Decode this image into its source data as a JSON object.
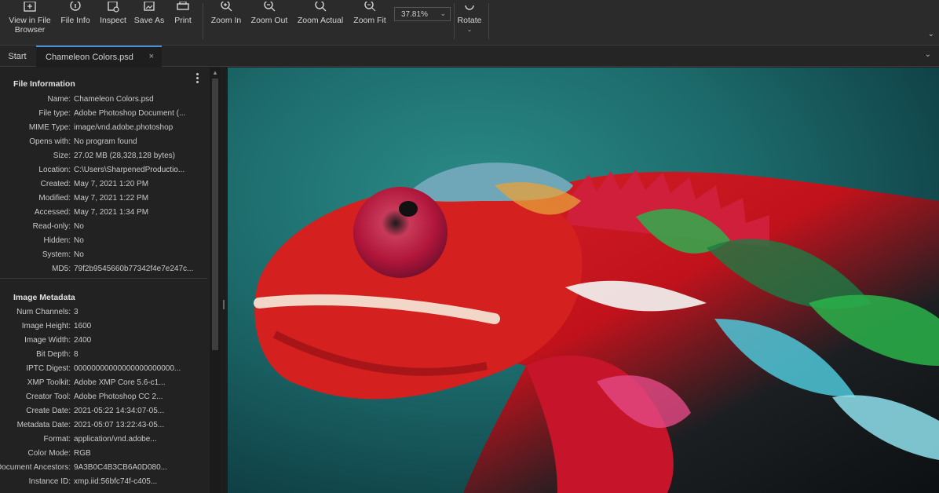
{
  "toolbar": {
    "buttons": [
      {
        "label": "View in File Browser",
        "line1": "View in File",
        "line2": "Browser",
        "icon": "folder-icon"
      },
      {
        "label": "File Info",
        "icon": "info-icon"
      },
      {
        "label": "Inspect",
        "icon": "inspect-icon"
      },
      {
        "label": "Save As",
        "icon": "save-as-icon"
      },
      {
        "label": "Print",
        "icon": "print-icon"
      },
      {
        "label": "Zoom In",
        "icon": "zoom-in-icon"
      },
      {
        "label": "Zoom Out",
        "icon": "zoom-out-icon"
      },
      {
        "label": "Zoom Actual",
        "icon": "zoom-actual-icon"
      },
      {
        "label": "Zoom Fit",
        "icon": "zoom-fit-icon"
      },
      {
        "label": "Rotate",
        "icon": "rotate-icon"
      }
    ],
    "zoom_value": "37.81%"
  },
  "tabs": {
    "start_label": "Start",
    "active_label": "Chameleon Colors.psd",
    "close_glyph": "×"
  },
  "file_info": {
    "title": "File Information",
    "rows": [
      {
        "key": "Name:",
        "value": "Chameleon Colors.psd"
      },
      {
        "key": "File type:",
        "value": "Adobe Photoshop Document (..."
      },
      {
        "key": "MIME Type:",
        "value": "image/vnd.adobe.photoshop"
      },
      {
        "key": "Opens with:",
        "value": "No program found"
      },
      {
        "key": "Size:",
        "value": "27.02 MB (28,328,128 bytes)"
      },
      {
        "key": "Location:",
        "value": "C:\\Users\\SharpenedProductio..."
      },
      {
        "key": "Created:",
        "value": "May 7, 2021 1:20 PM"
      },
      {
        "key": "Modified:",
        "value": "May 7, 2021 1:22 PM"
      },
      {
        "key": "Accessed:",
        "value": "May 7, 2021 1:34 PM"
      },
      {
        "key": "Read-only:",
        "value": "No"
      },
      {
        "key": "Hidden:",
        "value": "No"
      },
      {
        "key": "System:",
        "value": "No"
      },
      {
        "key": "MD5:",
        "value": "79f2b9545660b77342f4e7e247c..."
      }
    ]
  },
  "image_metadata": {
    "title": "Image Metadata",
    "rows": [
      {
        "key": "Num Channels:",
        "value": "3"
      },
      {
        "key": "Image Height:",
        "value": "1600"
      },
      {
        "key": "Image Width:",
        "value": "2400"
      },
      {
        "key": "Bit Depth:",
        "value": "8"
      },
      {
        "key": "IPTC Digest:",
        "value": "00000000000000000000000..."
      },
      {
        "key": "XMP Toolkit:",
        "value": "Adobe XMP Core 5.6-c1..."
      },
      {
        "key": "Creator Tool:",
        "value": "Adobe Photoshop CC 2..."
      },
      {
        "key": "Create Date:",
        "value": "2021-05:22 14:34:07-05..."
      },
      {
        "key": "Metadata Date:",
        "value": "2021-05:07 13:22:43-05..."
      },
      {
        "key": "Format:",
        "value": "application/vnd.adobe..."
      },
      {
        "key": "Color Mode:",
        "value": "RGB"
      },
      {
        "key": "Document Ancestors:",
        "value": "9A3B0C4B3CB6A0D080..."
      },
      {
        "key": "Instance ID:",
        "value": "xmp.iid:56bfc74f-c405..."
      }
    ]
  },
  "colors": {
    "accent": "#4a90d9",
    "background": "#1f1f1f"
  }
}
